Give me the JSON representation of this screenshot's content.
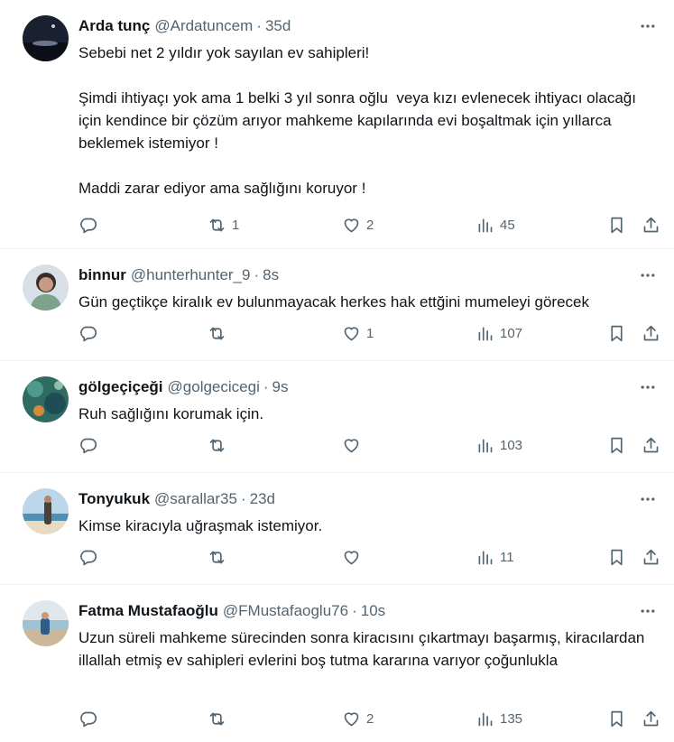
{
  "tweets": [
    {
      "name": "Arda tunç",
      "handle": "@Ardatuncem",
      "time": "35d",
      "text": "Sebebi net 2 yıldır yok sayılan ev sahipleri!\n\nŞimdi ihtiyaçı yok ama 1 belki 3 yıl sonra oğlu  veya kızı evlenecek ihtiyacı olacağı için kendince bir çözüm arıyor mahkeme kapılarında evi boşaltmak için yıllarca beklemek istemiyor !\n\nMaddi zarar ediyor ama sağlığını koruyor !",
      "replies": "",
      "retweets": "1",
      "likes": "2",
      "views": "45"
    },
    {
      "name": "binnur",
      "handle": "@hunterhunter_9",
      "time": "8s",
      "text": "Gün geçtikçe kiralık ev bulunmayacak herkes hak ettğini mumeleyi görecek",
      "replies": "",
      "retweets": "",
      "likes": "1",
      "views": "107"
    },
    {
      "name": "gölgeçiçeği",
      "handle": "@golgecicegi",
      "time": "9s",
      "text": "Ruh sağlığını korumak için.",
      "replies": "",
      "retweets": "",
      "likes": "",
      "views": "103"
    },
    {
      "name": "Tonyukuk",
      "handle": "@sarallar35",
      "time": "23d",
      "text": "Kimse kiracıyla uğraşmak istemiyor.",
      "replies": "",
      "retweets": "",
      "likes": "",
      "views": "11"
    },
    {
      "name": "Fatma Mustafaoğlu",
      "handle": "@FMustafaoglu76",
      "time": "10s",
      "text": "Uzun süreli mahkeme sürecinden sonra kiracısını çıkartmayı başarmış, kiracılardan illallah etmiş ev sahipleri evlerini boş tutma kararına varıyor çoğunlukla",
      "replies": "",
      "retweets": "",
      "likes": "2",
      "views": "135"
    }
  ],
  "icons": {
    "more": "more-horizontal-icon",
    "reply": "reply-icon",
    "retweet": "retweet-icon",
    "like": "heart-icon",
    "views": "views-chart-icon",
    "bookmark": "bookmark-icon",
    "share": "share-icon"
  },
  "colors": {
    "text": "#0f1419",
    "secondary": "#536471",
    "divider": "#eff3f4"
  }
}
